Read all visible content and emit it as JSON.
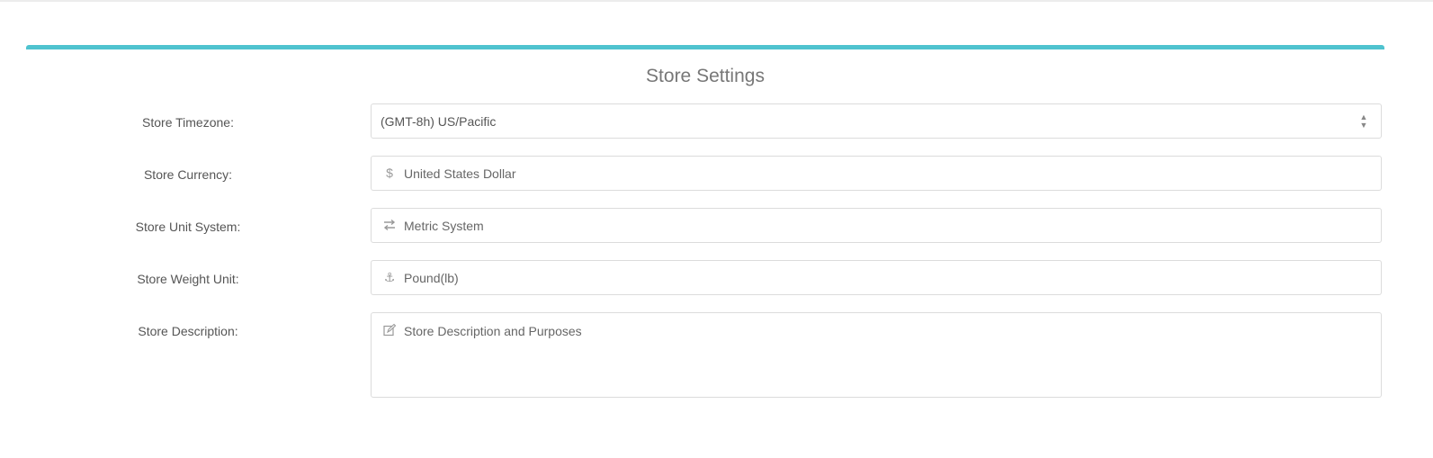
{
  "panel": {
    "title": "Store Settings",
    "accent_color": "#4fc3cf"
  },
  "form": {
    "timezone": {
      "label": "Store Timezone:",
      "value": "(GMT-8h) US/Pacific"
    },
    "currency": {
      "label": "Store Currency:",
      "icon": "dollar-icon",
      "value": "United States Dollar"
    },
    "unit_system": {
      "label": "Store Unit System:",
      "icon": "exchange-arrows-icon",
      "value": "Metric System"
    },
    "weight_unit": {
      "label": "Store Weight Unit:",
      "icon": "anchor-icon",
      "value": "Pound(lb)"
    },
    "description": {
      "label": "Store Description:",
      "icon": "edit-icon",
      "placeholder": "Store Description and Purposes"
    }
  }
}
